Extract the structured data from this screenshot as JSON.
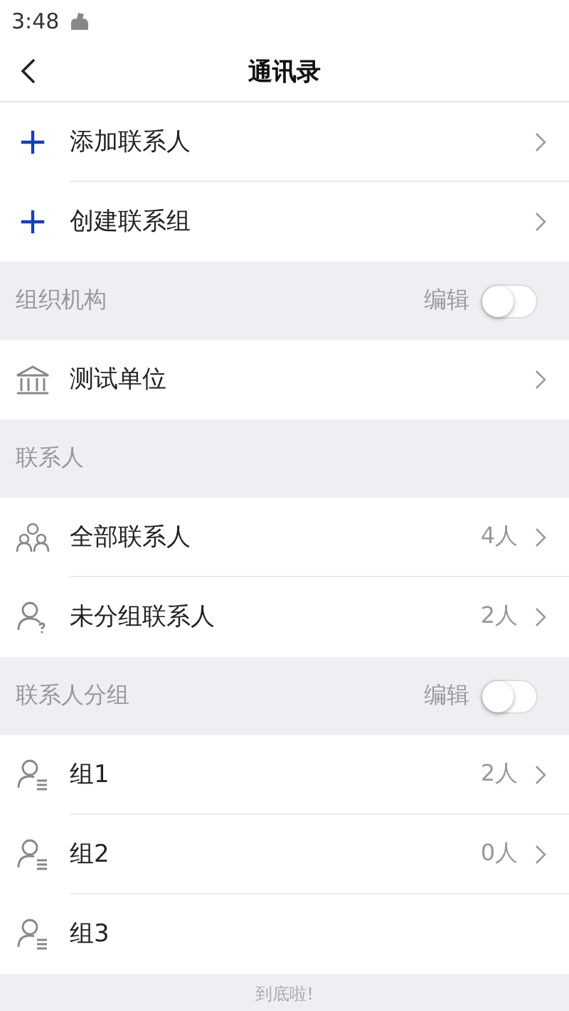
{
  "status_bar": {
    "time": "3:48"
  },
  "header": {
    "title": "通讯录"
  },
  "sections": [
    {
      "items": [
        {
          "kind": "plus",
          "label": "添加联系人",
          "chevron": true
        },
        {
          "kind": "plus",
          "label": "创建联系组",
          "chevron": true
        }
      ]
    },
    {
      "title": "组织机构",
      "edit": {
        "label": "编辑",
        "on": false
      },
      "items": [
        {
          "kind": "building",
          "label": "测试单位",
          "chevron": true
        }
      ]
    },
    {
      "title": "联系人",
      "items": [
        {
          "kind": "all",
          "label": "全部联系人",
          "count": "4人",
          "chevron": true
        },
        {
          "kind": "ungrouped",
          "label": "未分组联系人",
          "count": "2人",
          "chevron": true
        }
      ]
    },
    {
      "title": "联系人分组",
      "edit": {
        "label": "编辑",
        "on": false
      },
      "items": [
        {
          "kind": "group",
          "label": "组1",
          "count": "2人",
          "chevron": true
        },
        {
          "kind": "group",
          "label": "组2",
          "count": "0人",
          "chevron": true
        },
        {
          "kind": "group",
          "label": "组3",
          "chevron": false
        }
      ]
    }
  ],
  "footer": "到底啦!"
}
